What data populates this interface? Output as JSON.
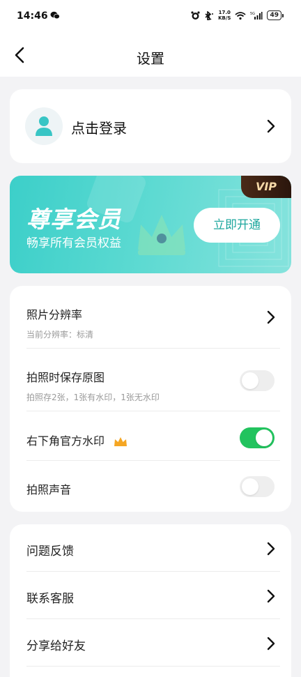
{
  "status_bar": {
    "time": "14:46",
    "net_speed_value": "17.0",
    "net_speed_unit": "KB/S",
    "battery": "49"
  },
  "nav": {
    "title": "设置"
  },
  "login": {
    "label": "点击登录"
  },
  "vip": {
    "title": "尊享会员",
    "subtitle": "畅享所有会员权益",
    "badge": "VIP",
    "button": "立即开通",
    "accent": "#3ccfc9"
  },
  "settings": [
    {
      "label": "照片分辨率",
      "sub": "当前分辨率：标清",
      "control": "chevron"
    },
    {
      "label": "拍照时保存原图",
      "sub": "拍照存2张，1张有水印，1张无水印",
      "control": "toggle",
      "on": false
    },
    {
      "label": "右下角官方水印",
      "control": "toggle",
      "on": true,
      "badge_icon": "crown-icon"
    },
    {
      "label": "拍照声音",
      "control": "toggle",
      "on": false
    }
  ],
  "menu": [
    {
      "label": "问题反馈"
    },
    {
      "label": "联系客服"
    },
    {
      "label": "分享给好友"
    }
  ],
  "colors": {
    "toggle_on": "#22c35e",
    "toggle_off": "#eeeeee",
    "crown": "#f5a623"
  }
}
